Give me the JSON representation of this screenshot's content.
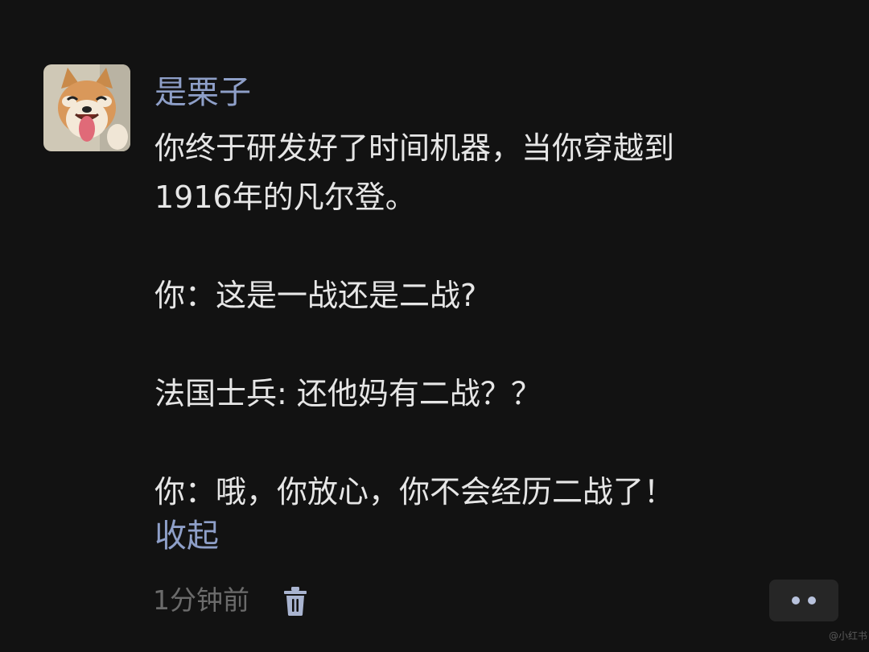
{
  "comment": {
    "username": "是栗子",
    "avatar_icon": "shiba-dog-avatar",
    "lines": [
      "你终于研发好了时间机器，当你穿越到",
      "1916年的凡尔登。",
      "",
      "你：这是一战还是二战?",
      "",
      "法国士兵: 还他妈有二战？？",
      "",
      "你：哦，你放心，你不会经历二战了！"
    ],
    "collapse_label": "收起",
    "timestamp": "1分钟前",
    "delete_icon": "trash-icon",
    "more_icon": "more-dots-icon",
    "watermark": "@小红书"
  },
  "colors": {
    "background": "#121212",
    "username": "#8e9fc8",
    "body_text": "#e6e6e6",
    "link": "#8e9fc8",
    "meta_text": "#6b6b6b",
    "more_button_bg": "#262626"
  }
}
